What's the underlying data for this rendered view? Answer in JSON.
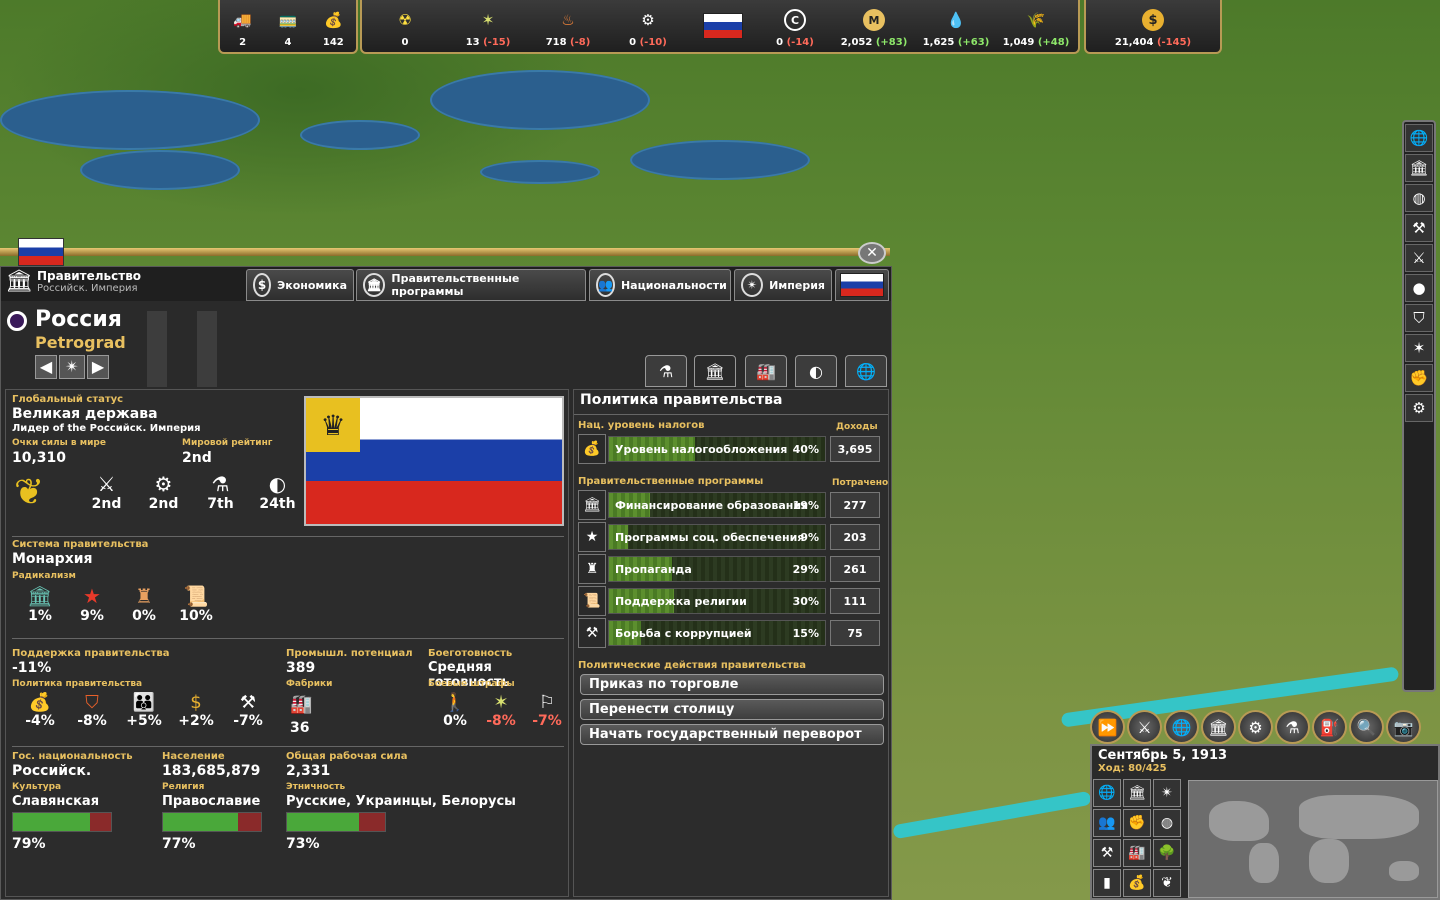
{
  "topbar": {
    "left": [
      {
        "icon": "truck-icon",
        "value": "2"
      },
      {
        "icon": "railcar-icon",
        "value": "4"
      },
      {
        "icon": "sack-icon",
        "value": "142"
      }
    ],
    "middle_left": [
      {
        "icon": "radiation-icon",
        "value": "0",
        "delta": ""
      },
      {
        "icon": "unrest-icon",
        "value": "13",
        "delta": "(-15)"
      },
      {
        "icon": "flame-bottle-icon",
        "value": "718",
        "delta": "(-8)"
      },
      {
        "icon": "gear-icon",
        "value": "0",
        "delta": "(-10)"
      }
    ],
    "middle_right": [
      {
        "icon": "c-badge-icon",
        "value": "0",
        "delta": "(-14)"
      },
      {
        "icon": "m-badge-icon",
        "value": "2,052",
        "delta": "(+83)"
      },
      {
        "icon": "oil-drop-icon",
        "value": "1,625",
        "delta": "(+63)"
      },
      {
        "icon": "wheat-icon",
        "value": "1,049",
        "delta": "(+48)"
      }
    ],
    "money": {
      "icon": "dollar-coin-icon",
      "value": "21,404",
      "delta": "(-145)"
    }
  },
  "panel": {
    "title": "Правительство",
    "subtitle": "Российск. Империя",
    "tabs": [
      {
        "label": "Экономика",
        "icon": "dollar-icon"
      },
      {
        "label": "Правительственные программы",
        "icon": "columns-icon"
      },
      {
        "label": "Национальности",
        "icon": "people-icon"
      },
      {
        "label": "Империя",
        "icon": "compass-icon"
      }
    ],
    "country": "Россия",
    "capital": "Petrograd"
  },
  "status": {
    "global_status_label": "Глобальный статус",
    "global_status": "Великая держава",
    "leader_of": "Лидер of the Российск. Империя",
    "power_label": "Очки силы в мире",
    "power": "10,310",
    "rank_label": "Мировой рейтинг",
    "rank": "2nd",
    "ranks": [
      {
        "icon": "crossed-swords-icon",
        "value": "2nd"
      },
      {
        "icon": "gear-icon",
        "value": "2nd"
      },
      {
        "icon": "flask-icon",
        "value": "7th"
      },
      {
        "icon": "sphere-icon",
        "value": "24th"
      }
    ]
  },
  "government": {
    "system_label": "Система правительства",
    "system": "Монархия",
    "radicalism_label": "Радикализм",
    "radicalism": [
      {
        "icon": "column-icon",
        "value": "1%"
      },
      {
        "icon": "red-star-icon",
        "value": "9%"
      },
      {
        "icon": "eagle-icon",
        "value": "0%"
      },
      {
        "icon": "scroll-icon",
        "value": "10%"
      }
    ]
  },
  "support": {
    "label": "Поддержка правительства",
    "value": "-11%",
    "policy_label": "Политика правительства",
    "items": [
      {
        "icon": "tax-bag-icon",
        "value": "-4%"
      },
      {
        "icon": "shield-emblem-icon",
        "value": "-8%"
      },
      {
        "icon": "family-icon",
        "value": "+5%"
      },
      {
        "icon": "dollar-coin-icon",
        "value": "+2%"
      },
      {
        "icon": "hammer-icon",
        "value": "-7%"
      }
    ],
    "industry_label": "Промышл. потенциал",
    "industry": "389",
    "factories_label": "Фабрики",
    "factories": "36",
    "readiness_label": "Боеготовность",
    "readiness": "Средняя готовность",
    "penalties_label": "Боевые штрафы",
    "penalties": [
      {
        "icon": "soldier-icon",
        "value": "0%"
      },
      {
        "icon": "unrest-icon",
        "value": "-8%"
      },
      {
        "icon": "white-flag-icon",
        "value": "-7%"
      }
    ]
  },
  "nation": {
    "nationality_label": "Гос. национальность",
    "nationality": "Российск.",
    "culture_label": "Культура",
    "culture": "Славянская",
    "culture_pct": "79%",
    "culture_frac": 0.79,
    "population_label": "Население",
    "population": "183,685,879",
    "religion_label": "Религия",
    "religion": "Православие",
    "religion_pct": "77%",
    "religion_frac": 0.77,
    "workforce_label": "Общая рабочая сила",
    "workforce": "2,331",
    "ethnicity_label": "Этничность",
    "ethnicity": "Русские, Украинцы, Белорусы",
    "ethnicity_pct": "73%",
    "ethnicity_frac": 0.73
  },
  "policy": {
    "title": "Политика правительства",
    "tax_section": "Нац. уровень налогов",
    "income_label": "Доходы",
    "tax": {
      "name": "Уровень налогообложения",
      "pct": "40%",
      "frac": 0.4,
      "value": "3,695"
    },
    "programs_section": "Правительственные программы",
    "spent_label": "Потрачено",
    "programs": [
      {
        "icon": "column-icon",
        "name": "Финансирование образования",
        "pct": "19%",
        "frac": 0.19,
        "value": "277"
      },
      {
        "icon": "star-icon",
        "name": "Программы соц. обеспечения",
        "pct": "9%",
        "frac": 0.09,
        "value": "203"
      },
      {
        "icon": "eagle-icon",
        "name": "Пропаганда",
        "pct": "29%",
        "frac": 0.29,
        "value": "261"
      },
      {
        "icon": "scroll-icon",
        "name": "Поддержка религии",
        "pct": "30%",
        "frac": 0.3,
        "value": "111"
      },
      {
        "icon": "gavel-icon",
        "name": "Борьба с коррупцией",
        "pct": "15%",
        "frac": 0.15,
        "value": "75"
      }
    ],
    "actions_section": "Политические действия правительства",
    "actions": [
      "Приказ по торговле",
      "Перенести столицу",
      "Начать государственный переворот"
    ]
  },
  "date": {
    "text": "Сентябрь 5, 1913",
    "turn": "Ход: 80/425"
  },
  "colors": {
    "accent": "#e8c060",
    "negative": "#ff6a5a",
    "positive": "#8ee86a"
  }
}
